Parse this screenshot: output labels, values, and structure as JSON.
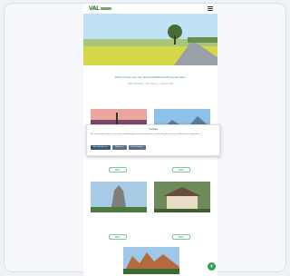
{
  "header": {
    "logo_text": "VAL",
    "menu_icon": "hamburger-icon"
  },
  "intro": {
    "title": "Willkommen bei der Gedenkstättenstiftung Sachsen",
    "subtitle": "Mehr erfahren · Erinnerung · Geschichte"
  },
  "tiles": [
    {
      "label": "",
      "button": "Mehr"
    },
    {
      "label": "",
      "button": "Mehr"
    },
    {
      "label": "",
      "button": "Mehr"
    },
    {
      "label": "",
      "button": "Mehr"
    }
  ],
  "cookie": {
    "title": "Cookies",
    "text": "Wir verwenden Cookies, um Inhalte und Anzeigen zu personalisieren und die Zugriffe auf unsere Website zu analysieren.",
    "buttons": [
      "Alle akzeptieren",
      "Ablehnen",
      "Einstellungen"
    ]
  },
  "colors": {
    "brand_green": "#2e9d55",
    "hero_sky": "#bfe3f5",
    "hero_field": "#d6d84a"
  }
}
